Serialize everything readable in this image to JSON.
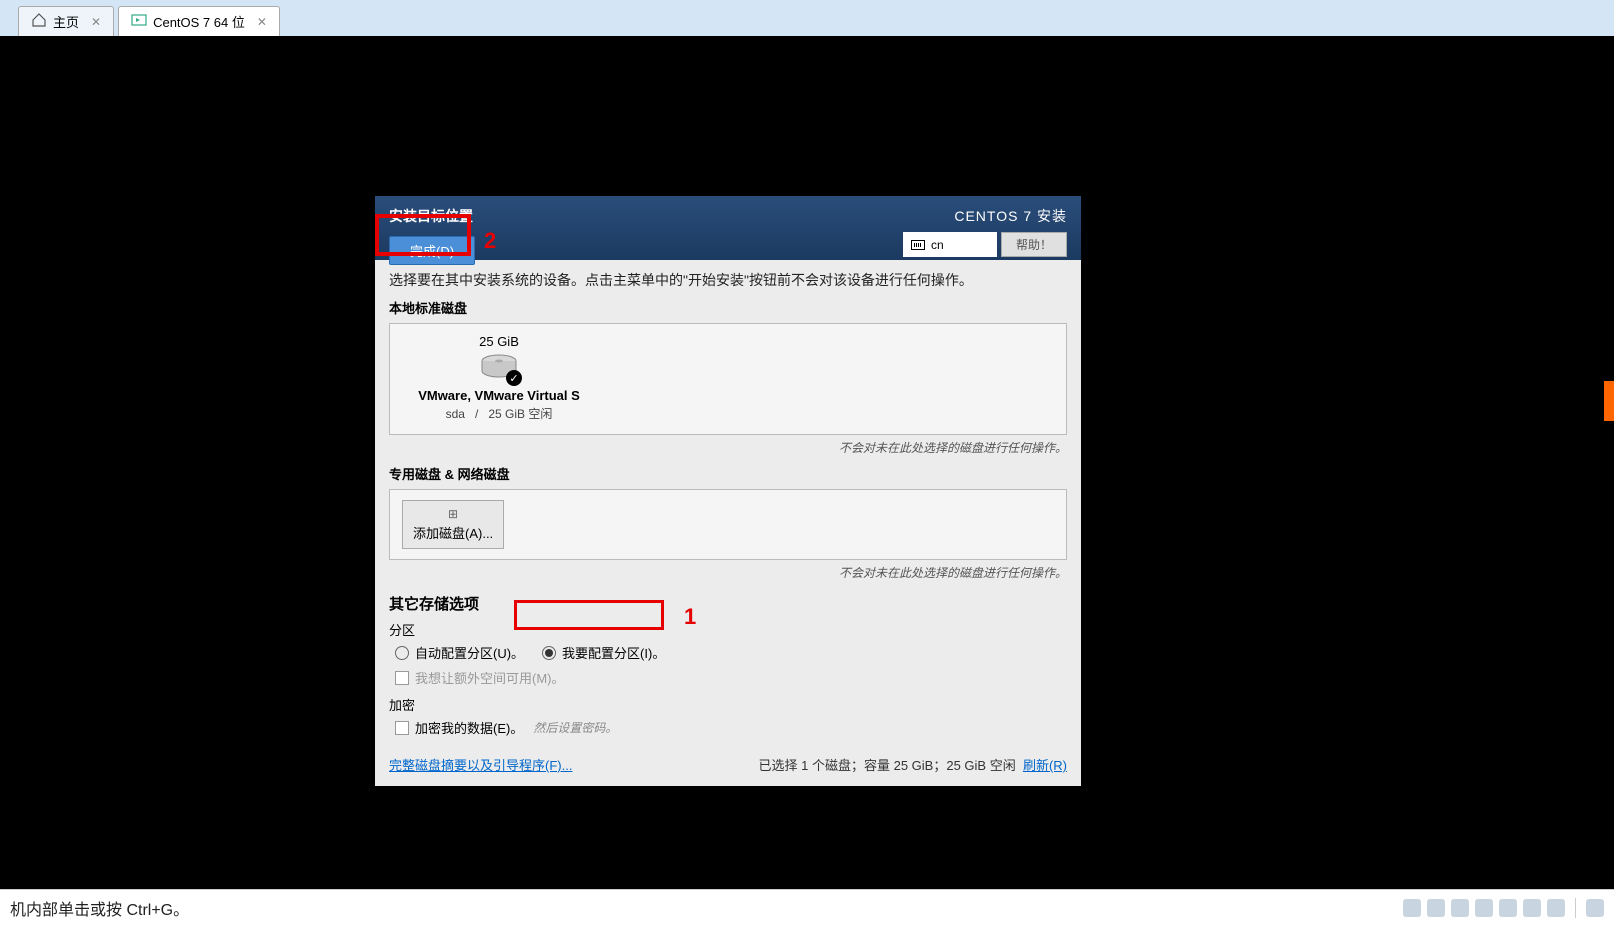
{
  "tabs": {
    "home": {
      "label": "主页"
    },
    "vm": {
      "label": "CentOS 7 64 位"
    }
  },
  "installer": {
    "header": {
      "title": "安装目标位置",
      "done_button": "完成(D)",
      "brand": "CENTOS 7 安装",
      "lang": "cn",
      "help": "帮助！"
    },
    "body": {
      "instruction": "选择要在其中安装系统的设备。点击主菜单中的\"开始安装\"按钮前不会对该设备进行任何操作。",
      "local_disks_label": "本地标准磁盘",
      "disk": {
        "size": "25 GiB",
        "name": "VMware, VMware Virtual S",
        "device": "sda",
        "sep": "/",
        "free": "25 GiB 空闲"
      },
      "hint_unselected": "不会对未在此处选择的磁盘进行任何操作。",
      "special_disks_label": "专用磁盘 & 网络磁盘",
      "add_disk_button": "添加磁盘(A)...",
      "storage_options_title": "其它存储选项",
      "partition_label": "分区",
      "radio_auto": "自动配置分区(U)。",
      "radio_manual": "我要配置分区(I)。",
      "checkbox_extra_space": "我想让额外空间可用(M)。",
      "encrypt_label": "加密",
      "checkbox_encrypt": "加密我的数据(E)。",
      "encrypt_hint": "然后设置密码。",
      "footer": {
        "full_summary_link": "完整磁盘摘要以及引导程序(F)...",
        "summary": "已选择 1 个磁盘；容量 25 GiB；25 GiB 空闲",
        "refresh_link": "刷新(R)"
      }
    }
  },
  "annotations": {
    "one": "1",
    "two": "2"
  },
  "status_bar": {
    "text": "机内部单击或按 Ctrl+G。"
  }
}
